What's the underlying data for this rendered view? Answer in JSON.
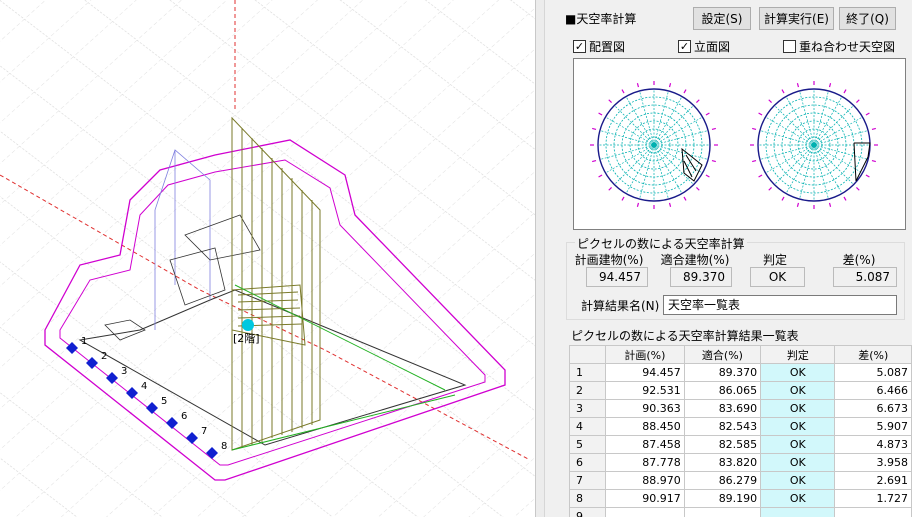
{
  "toolbar": {
    "title": "■天空率計算",
    "settings_label": "設定(S)",
    "execute_label": "計算実行(E)",
    "exit_label": "終了(Q)"
  },
  "options": {
    "layout_label": "配置図",
    "layout_checked": true,
    "elevation_label": "立面図",
    "elevation_checked": true,
    "overlay_label": "重ね合わせ天空図",
    "overlay_checked": false
  },
  "viewport": {
    "floor_tag": "[2階]",
    "point_labels": [
      "1",
      "2",
      "3",
      "4",
      "5",
      "6",
      "7",
      "8"
    ]
  },
  "pixel_calc": {
    "group_title": "ピクセルの数による天空率計算",
    "col_plan": "計画建物(%)",
    "col_fit": "適合建物(%)",
    "col_judge": "判定",
    "col_diff": "差(%)",
    "plan": "94.457",
    "fit": "89.370",
    "judge": "OK",
    "diff": "5.087",
    "result_name_label": "計算結果名(N)",
    "result_name": "天空率一覧表"
  },
  "list": {
    "title": "ピクセルの数による天空率計算結果一覧表",
    "headers": [
      "",
      "計画(%)",
      "適合(%)",
      "判定",
      "差(%)"
    ],
    "rows": [
      [
        "1",
        "94.457",
        "89.370",
        "OK",
        "5.087"
      ],
      [
        "2",
        "92.531",
        "86.065",
        "OK",
        "6.466"
      ],
      [
        "3",
        "90.363",
        "83.690",
        "OK",
        "6.673"
      ],
      [
        "4",
        "88.450",
        "82.543",
        "OK",
        "5.907"
      ],
      [
        "5",
        "87.458",
        "82.585",
        "OK",
        "4.873"
      ],
      [
        "6",
        "87.778",
        "83.820",
        "OK",
        "3.958"
      ],
      [
        "7",
        "88.970",
        "86.279",
        "OK",
        "2.691"
      ],
      [
        "8",
        "90.917",
        "89.190",
        "OK",
        "1.727"
      ],
      [
        "9",
        "",
        "",
        "",
        ""
      ]
    ]
  },
  "colors": {
    "grid_line": "#d8d8d8",
    "boundary": "#d000d0",
    "building": "#7a7a2a",
    "marker": "#1020d0",
    "ok_cell": "#d2f8fb",
    "dome": "#00b0b0"
  }
}
